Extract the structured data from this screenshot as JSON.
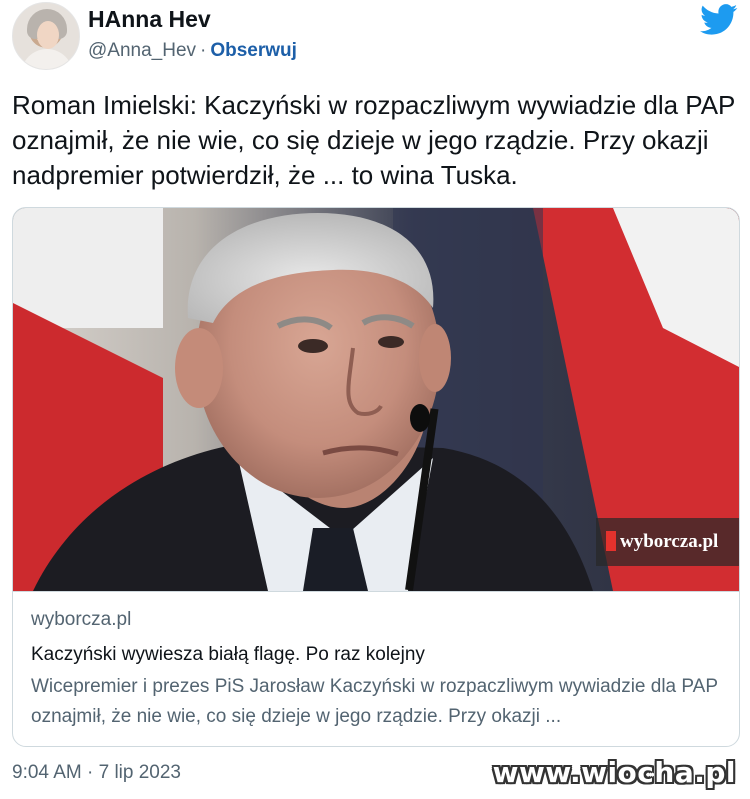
{
  "author": {
    "display_name": "HAnna Hev",
    "handle": "@Anna_Hev",
    "separator": "·",
    "follow_label": "Obserwuj"
  },
  "tweet": {
    "text": "Roman Imielski: Kaczyński w rozpaczliwym wywiadzie dla PAP oznajmił, że nie wie, co się dzieje w jego rządzie. Przy okazji nadpremier potwierdził, że ... to wina Tuska.",
    "timestamp": "9:04 AM · 7 lip 2023"
  },
  "card": {
    "image_watermark": "wyborcza.pl",
    "domain": "wyborcza.pl",
    "title": "Kaczyński wywiesza białą flagę. Po raz kolejny",
    "description": "Wicepremier i prezes PiS Jarosław Kaczyński w rozpaczliwym wywiadzie dla PAP oznajmił, że nie wie, co się dzieje w jego rządzie. Przy okazji ..."
  },
  "site_watermark": "www.wiocha.pl",
  "icons": {
    "brand": "twitter-bird-icon",
    "avatar": "avatar-photo"
  },
  "colors": {
    "twitter_blue": "#1d9bf0",
    "follow_link": "#1d5fa8",
    "secondary_text": "#536471",
    "border": "#cfd9de"
  }
}
